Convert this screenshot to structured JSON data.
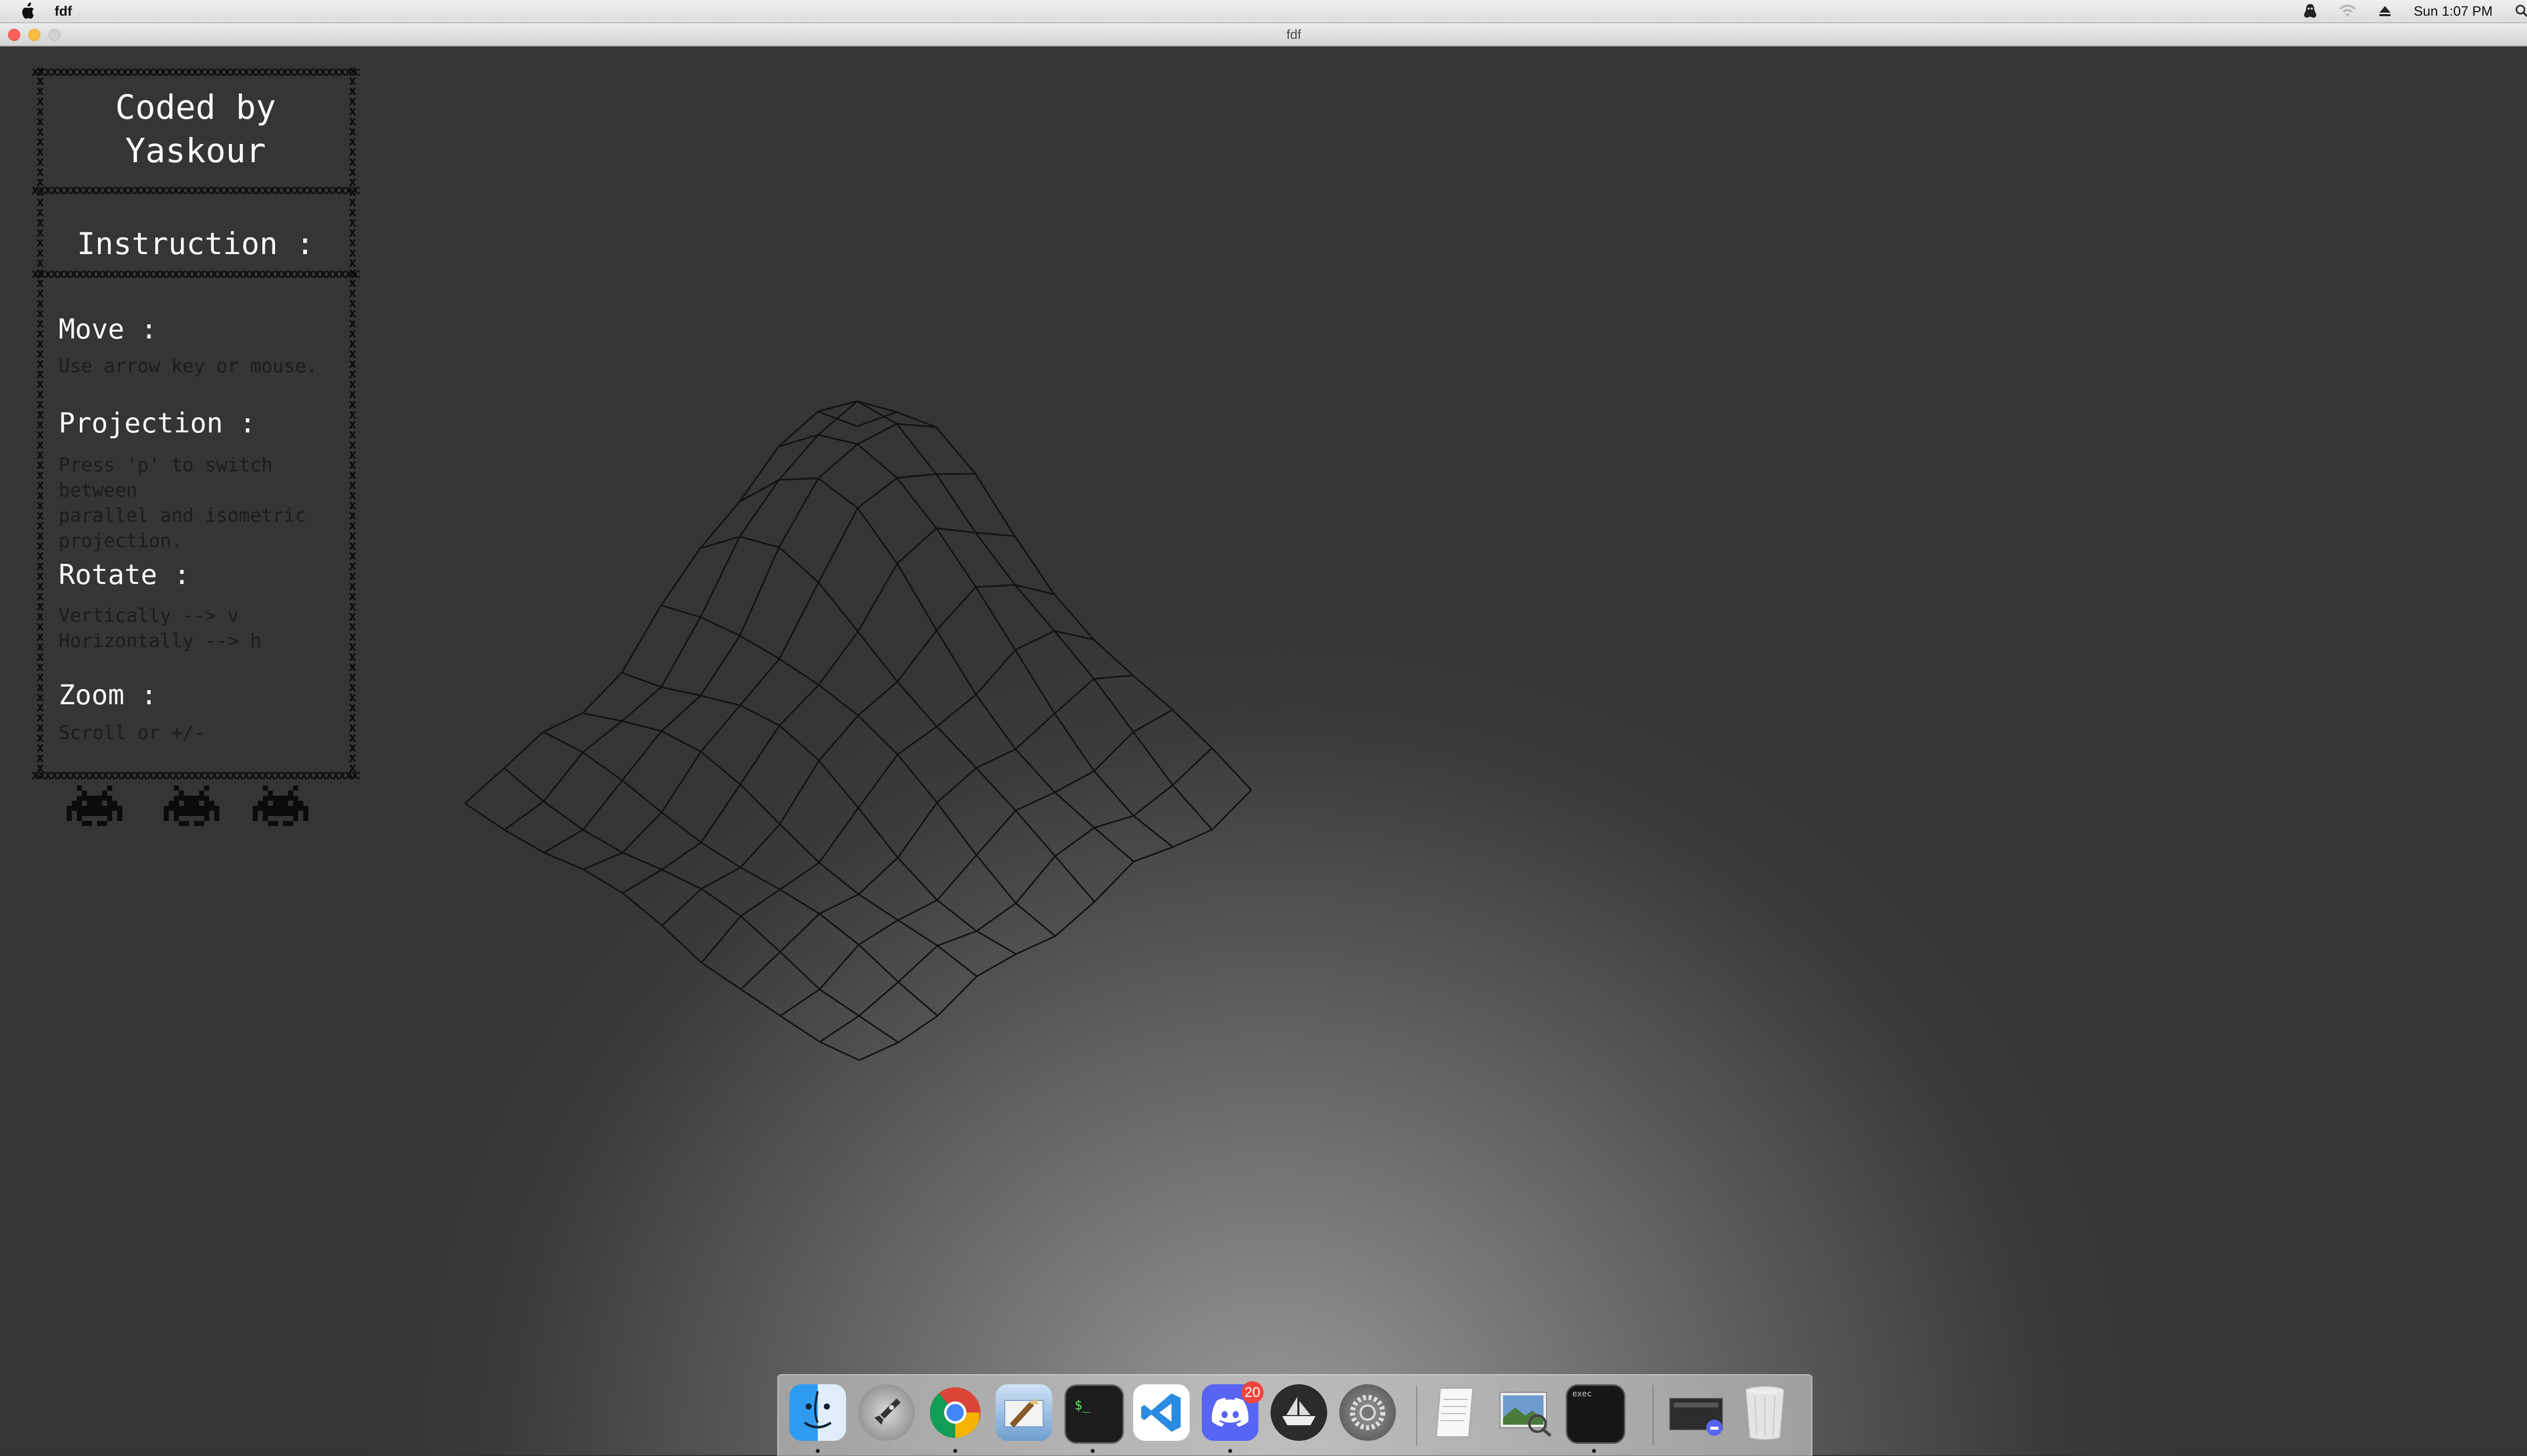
{
  "menubar": {
    "app_name": "fdf",
    "clock": "Sun 1:07 PM",
    "icons": [
      "apple-icon",
      "status-app-icon",
      "wifi-icon",
      "eject-icon",
      "spotlight-search-icon",
      "notification-center-icon"
    ]
  },
  "window": {
    "title": "fdf"
  },
  "panel": {
    "credit_line1": "Coded by",
    "credit_line2": "Yaskour",
    "instruction_heading": "Instruction :",
    "sections": [
      {
        "title": "Move :",
        "lines": [
          "Use arrow key or mouse."
        ]
      },
      {
        "title": "Projection :",
        "lines": [
          "Press 'p' to switch between",
          "parallel and isometric",
          "projection."
        ]
      },
      {
        "title": "Rotate :",
        "lines": [
          "Vertically --> v",
          "Horizontally --> h"
        ]
      },
      {
        "title": "Zoom :",
        "lines": [
          "Scroll or +/-"
        ]
      }
    ],
    "decoration_icons": [
      "space-invader-icon",
      "space-invader-icon",
      "space-invader-icon"
    ]
  },
  "wireframe": {
    "grid_rows": 11,
    "grid_cols": 11,
    "line_color": "#111111",
    "heights_description_icon": "terrain-mesh"
  },
  "dock": {
    "apps": [
      {
        "name": "Finder",
        "icon": "finder-icon",
        "running": true
      },
      {
        "name": "Launchpad",
        "icon": "launchpad-icon",
        "running": false
      },
      {
        "name": "Google Chrome",
        "icon": "chrome-icon",
        "running": true
      },
      {
        "name": "Mail",
        "icon": "mail-icon",
        "running": false
      },
      {
        "name": "Terminal",
        "icon": "terminal-icon",
        "running": true
      },
      {
        "name": "Visual Studio Code",
        "icon": "vscode-icon",
        "running": false
      },
      {
        "name": "Discord",
        "icon": "discord-icon",
        "running": true,
        "badge": "20"
      },
      {
        "name": "Pages",
        "icon": "pages-ship-icon",
        "running": false
      },
      {
        "name": "System Preferences",
        "icon": "system-preferences-icon",
        "running": false
      }
    ],
    "documents": [
      {
        "name": "TextEdit",
        "icon": "textedit-icon",
        "running": false
      },
      {
        "name": "Preview",
        "icon": "preview-icon",
        "running": false
      },
      {
        "name": "exec",
        "icon": "exec-terminal-icon",
        "running": true,
        "label": "exec"
      }
    ],
    "stack": [
      {
        "name": "Downloads",
        "icon": "downloads-stack-icon"
      },
      {
        "name": "Trash",
        "icon": "trash-icon"
      }
    ],
    "colors": {
      "badge": "#f1453d",
      "discord": "#5865f2",
      "vscode": "#2a8be0"
    }
  }
}
